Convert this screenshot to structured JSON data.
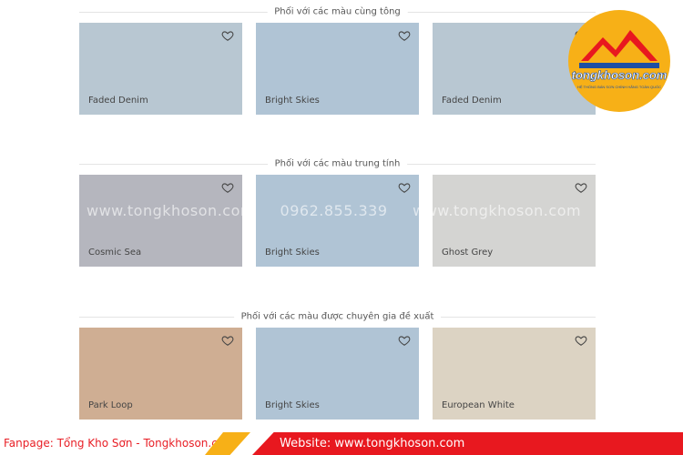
{
  "sections": [
    {
      "title": "Phối với các màu cùng tông",
      "swatches": [
        {
          "name": "Faded Denim",
          "color": "#b8c7d2"
        },
        {
          "name": "Bright Skies",
          "color": "#b0c4d5"
        },
        {
          "name": "Faded Denim",
          "color": "#b8c7d2"
        }
      ]
    },
    {
      "title": "Phối với các màu trung tính",
      "swatches": [
        {
          "name": "Cosmic Sea",
          "color": "#b5b6be"
        },
        {
          "name": "Bright Skies",
          "color": "#b0c4d5"
        },
        {
          "name": "Ghost Grey",
          "color": "#d4d4d2"
        }
      ]
    },
    {
      "title": "Phối với các màu được chuyên gia đề xuất",
      "swatches": [
        {
          "name": "Park Loop",
          "color": "#cfae93"
        },
        {
          "name": "Bright Skies",
          "color": "#b0c4d5"
        },
        {
          "name": "European White",
          "color": "#dcd3c3"
        }
      ]
    }
  ],
  "watermark": [
    "www.tongkhoson.com",
    "0962.855.339",
    "www.tongkhoson.com",
    "0962.8"
  ],
  "logo": {
    "brand": "tongkhoson.com",
    "tagline": "HỆ THỐNG BÁN SƠN CHÍNH HÃNG TOÀN QUỐC",
    "bg_color": "#f7b017"
  },
  "footer": {
    "fanpage": "Fanpage: Tổng Kho Sơn - Tongkhoson.com",
    "website": "Website: www.tongkhoson.com",
    "accent_color": "#e8181f"
  },
  "icons": {
    "favorite": "heart-outline-icon"
  }
}
